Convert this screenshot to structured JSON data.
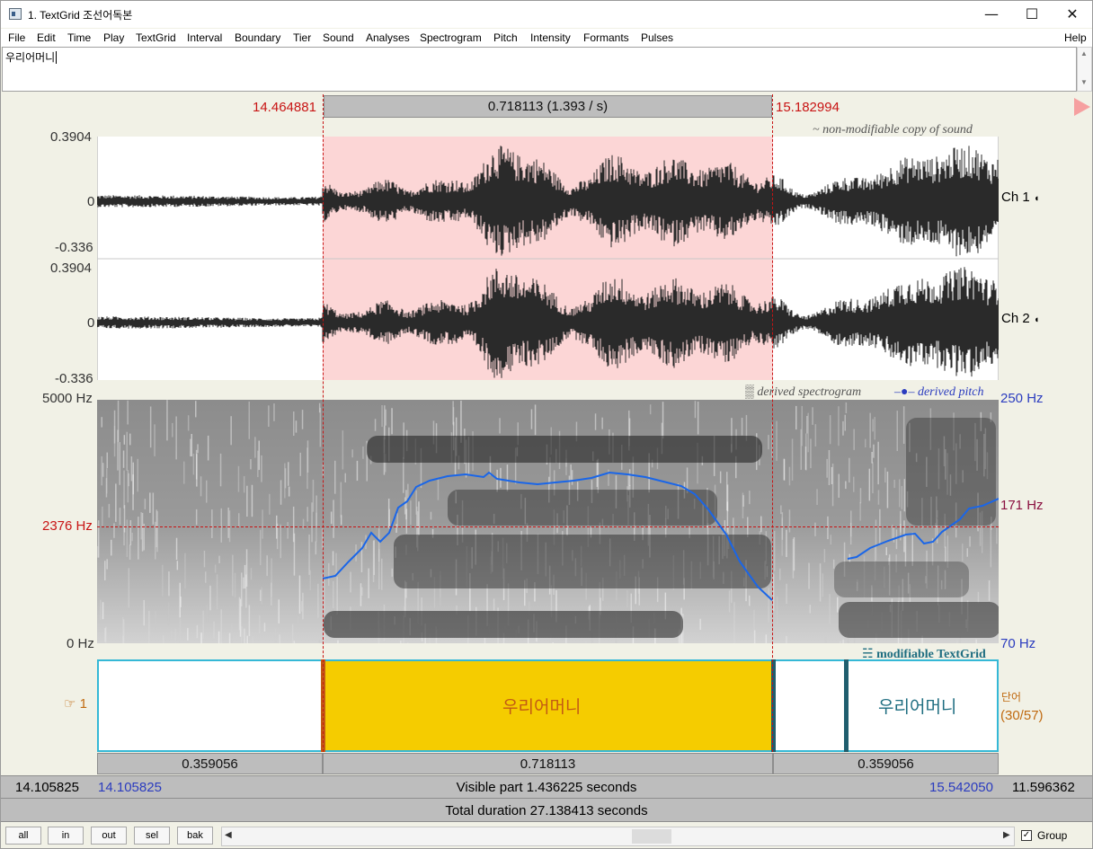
{
  "window": {
    "title": "1. TextGrid 조선어독본"
  },
  "window_controls": {
    "minimize": "—",
    "maximize": "☐",
    "close": "✕"
  },
  "menu": [
    "File",
    "Edit",
    "Time",
    "Play",
    "TextGrid",
    "Interval",
    "Boundary",
    "Tier",
    "Sound",
    "Analyses",
    "Spectrogram",
    "Pitch",
    "Intensity",
    "Formants",
    "Pulses"
  ],
  "help_menu": "Help",
  "text_field": {
    "value": "우리어머니"
  },
  "selection": {
    "start": "14.464881",
    "end": "15.182994",
    "duration": "0.718113 (1.393 / s)"
  },
  "sound": {
    "note": "~ non-modifiable copy of sound",
    "channels": [
      {
        "label": "Ch 1",
        "ymax": "0.3904",
        "zero": "0",
        "ymin": "-0.336"
      },
      {
        "label": "Ch 2",
        "ymax": "0.3904",
        "zero": "0",
        "ymin": "-0.336"
      }
    ]
  },
  "spectrogram": {
    "note": "derived spectrogram",
    "pitch_note": "derived pitch",
    "freq_top": "5000 Hz",
    "freq_cursor": "2376 Hz",
    "freq_bottom": "0 Hz",
    "pitch_top": "250 Hz",
    "pitch_cursor": "171 Hz",
    "pitch_bottom": "70 Hz"
  },
  "textgrid": {
    "note": "modifiable TextGrid",
    "tier_number": "1",
    "tier_name": "단어",
    "tier_count": "(30/57)",
    "intervals": [
      {
        "text": "",
        "duration": "0.359056"
      },
      {
        "text": "우리어머니",
        "duration": "0.718113",
        "selected": true
      },
      {
        "text": "",
        "duration": ""
      },
      {
        "text": "우리어머니",
        "duration": ""
      }
    ],
    "right_duration": "0.359056"
  },
  "time_bar": {
    "window_start": "14.105825",
    "visible_start": "14.105825",
    "visible_label": "Visible part 1.436225 seconds",
    "visible_end": "15.542050",
    "window_end": "11.596362",
    "total_label": "Total duration 27.138413 seconds"
  },
  "toolbar": {
    "buttons": [
      "all",
      "in",
      "out",
      "sel",
      "bak"
    ],
    "group_label": "Group",
    "group_checked": true
  }
}
